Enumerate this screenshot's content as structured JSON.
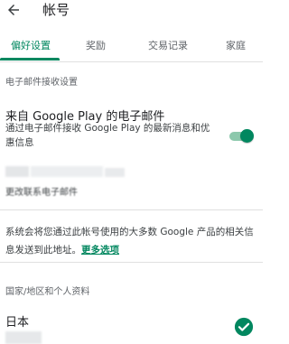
{
  "header": {
    "back_icon": "arrow-left-icon",
    "title": "帐号"
  },
  "tabs": [
    {
      "label": "偏好设置",
      "active": true
    },
    {
      "label": "奖励",
      "active": false
    },
    {
      "label": "交易记录",
      "active": false
    },
    {
      "label": "家庭",
      "active": false
    }
  ],
  "email_section": {
    "header": "电子邮件接收设置",
    "setting_title": "来自 Google Play 的电子邮件",
    "setting_desc": "通过电子邮件接收 Google Play 的最新消息和优惠信息",
    "toggle_on": true,
    "change_contact_label": "更改联系电子邮件",
    "notice_text": "系统会将您通过此帐号使用的大多数 Google 产品的相关信息发送到此地址。",
    "more_options_link": "更多选项"
  },
  "country_section": {
    "header": "国家/地区和个人资料",
    "country": "日本",
    "check_icon": "check-circle-icon"
  },
  "colors": {
    "accent": "#01875f",
    "toggle_track": "#8cc8ac",
    "divider": "#e0e0e0"
  }
}
